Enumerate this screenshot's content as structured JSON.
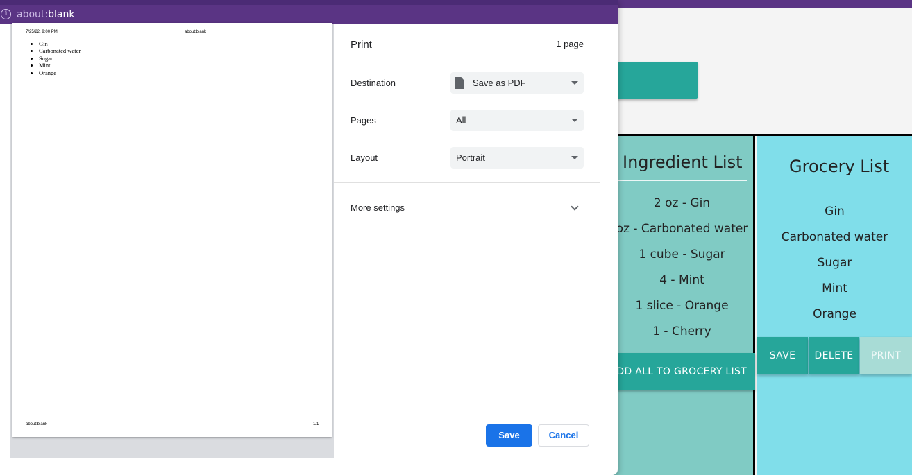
{
  "popup": {
    "url_scheme": "about:",
    "url_host": "blank"
  },
  "print_preview": {
    "header_date": "7/25/22, 9:00 PM",
    "header_title": "about:blank",
    "items": [
      "Gin",
      "Carbonated water",
      "Sugar",
      "Mint",
      "Orange"
    ],
    "footer_url": "about:blank",
    "footer_page": "1/1"
  },
  "print_settings": {
    "title": "Print",
    "page_count": "1 page",
    "destination_label": "Destination",
    "destination_value": "Save as PDF",
    "pages_label": "Pages",
    "pages_value": "All",
    "layout_label": "Layout",
    "layout_value": "Portrait",
    "more_settings": "More settings",
    "save_label": "Save",
    "cancel_label": "Cancel"
  },
  "ingredient_panel": {
    "title": "Ingredient List",
    "items": [
      "2 oz - Gin",
      "oz - Carbonated water",
      "1 cube - Sugar",
      "4 - Mint",
      "1 slice - Orange",
      "1 - Cherry"
    ],
    "add_all_label": "DD ALL TO GROCERY LIST"
  },
  "grocery_panel": {
    "title": "Grocery List",
    "items": [
      "Gin",
      "Carbonated water",
      "Sugar",
      "Mint",
      "Orange"
    ],
    "save_label": "SAVE",
    "delete_label": "DELETE",
    "print_label": "PRINT"
  },
  "colors": {
    "browser_purple": "#5a3484",
    "teal": "#26a69a",
    "ingredient_bg": "#80cbc4",
    "grocery_bg": "#80deea",
    "chrome_blue": "#1a73e8"
  }
}
